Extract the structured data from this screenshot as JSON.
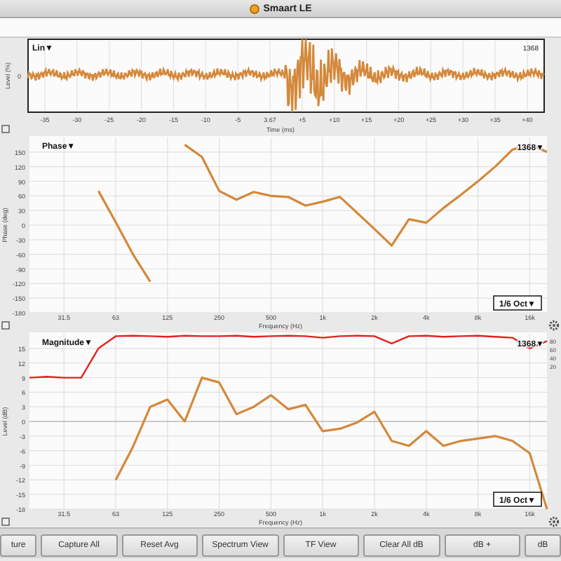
{
  "window": {
    "title": "Smaart LE"
  },
  "impulse": {
    "label": "Lin▼",
    "count": "1368",
    "ylabel": "Level (%)",
    "ytick": "0",
    "xlabel": "Time (ms)",
    "xticks": [
      "-35",
      "-30",
      "-25",
      "-20",
      "-15",
      "-10",
      "-5",
      "3.67",
      "+5",
      "+10",
      "+15",
      "+20",
      "+25",
      "+30",
      "+35",
      "+40"
    ]
  },
  "phase": {
    "label": "Phase▼",
    "count": "1368▼",
    "smoothing": "1/6 Oct▼",
    "chart_data": {
      "type": "line",
      "xlabel": "Frequency (Hz)",
      "ylabel": "Phase (deg)",
      "categories": [
        null,
        null,
        "31.5",
        null,
        null,
        "63",
        null,
        null,
        "125",
        null,
        null,
        "250",
        null,
        null,
        "500",
        null,
        null,
        "1k",
        null,
        null,
        "2k",
        null,
        null,
        "4k",
        null,
        null,
        "8k",
        null,
        null,
        "16k",
        null
      ],
      "series": [
        {
          "color": "#d4883a",
          "values": [
            null,
            null,
            null,
            null,
            70,
            6,
            -60,
            -116,
            null,
            165,
            140,
            70,
            52,
            68,
            60,
            58,
            40,
            48,
            58,
            25,
            -8,
            -42,
            12,
            5,
            35,
            62,
            90,
            120,
            155,
            166,
            150
          ]
        }
      ],
      "grid": true,
      "ylim": [
        -180,
        180
      ],
      "yticks": [
        -180,
        -150,
        -120,
        -90,
        -60,
        -30,
        0,
        30,
        60,
        90,
        120,
        150
      ]
    }
  },
  "magnitude": {
    "label": "Magnitude▼",
    "count": "1368▼",
    "smoothing": "1/6 Oct▼",
    "coherence_ticks": [
      "80",
      "60",
      "40",
      "20"
    ],
    "chart_data": {
      "type": "line",
      "xlabel": "Frequency (Hz)",
      "ylabel": "Level (dB)",
      "categories": [
        null,
        null,
        "31.5",
        null,
        null,
        "63",
        null,
        null,
        "125",
        null,
        null,
        "250",
        null,
        null,
        "500",
        null,
        null,
        "1k",
        null,
        null,
        "2k",
        null,
        null,
        "4k",
        null,
        null,
        "8k",
        null,
        null,
        "16k",
        null
      ],
      "series": [
        {
          "color": "#e3211f",
          "values": [
            9,
            9.2,
            9,
            9,
            15,
            17.5,
            17.6,
            17.5,
            17.4,
            17.6,
            17.5,
            17.5,
            17.6,
            17.4,
            17.5,
            17.6,
            17.5,
            17.2,
            17.5,
            17.6,
            17.5,
            16,
            17.5,
            17.6,
            17.4,
            17.5,
            17.6,
            17.4,
            17.2,
            15,
            16.5
          ]
        },
        {
          "color": "#d4883a",
          "values": [
            null,
            null,
            null,
            null,
            null,
            -12,
            -5.2,
            3,
            4.5,
            0,
            9,
            8,
            1.5,
            3,
            5.4,
            2.5,
            3.4,
            -2,
            -1.5,
            -0.2,
            2,
            -4,
            -5,
            -2,
            -5,
            -4,
            -3.5,
            -3,
            -4,
            -6.5,
            -18
          ]
        }
      ],
      "grid": true,
      "ylim": [
        -18,
        18
      ],
      "yticks": [
        -18,
        -15,
        -12,
        -9,
        -6,
        -3,
        0,
        3,
        6,
        9,
        12,
        15
      ]
    }
  },
  "buttons": [
    "ture",
    "Capture All",
    "Reset Avg",
    "Spectrum View",
    "TF View",
    "Clear All dB",
    "dB +",
    "dB"
  ]
}
